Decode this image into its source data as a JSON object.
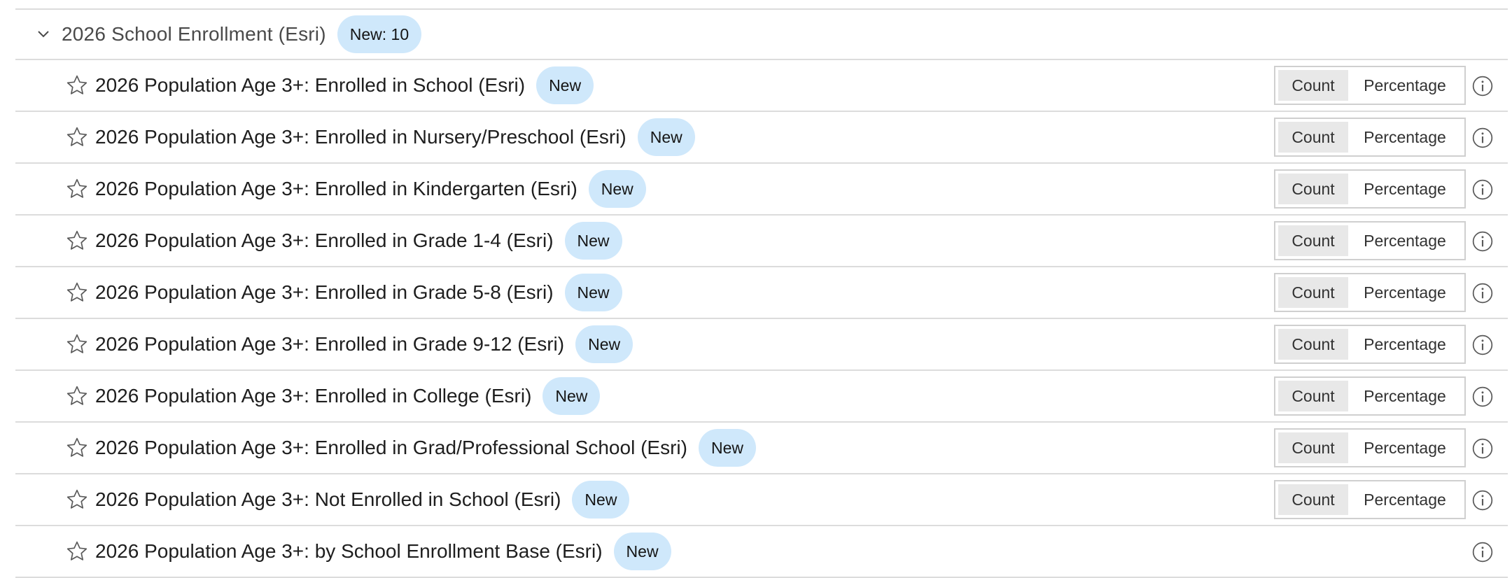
{
  "group": {
    "title": "2026 School Enrollment (Esri)",
    "badge": "New: 10",
    "expanded": true
  },
  "rows": [
    {
      "label": "2026 Population Age 3+: Enrolled in School (Esri)",
      "badge": "New",
      "count_label": "Count",
      "pct_label": "Percentage",
      "has_toggle": true
    },
    {
      "label": "2026 Population Age 3+: Enrolled in Nursery/Preschool (Esri)",
      "badge": "New",
      "count_label": "Count",
      "pct_label": "Percentage",
      "has_toggle": true
    },
    {
      "label": "2026 Population Age 3+: Enrolled in Kindergarten (Esri)",
      "badge": "New",
      "count_label": "Count",
      "pct_label": "Percentage",
      "has_toggle": true
    },
    {
      "label": "2026 Population Age 3+: Enrolled in Grade 1-4 (Esri)",
      "badge": "New",
      "count_label": "Count",
      "pct_label": "Percentage",
      "has_toggle": true
    },
    {
      "label": "2026 Population Age 3+: Enrolled in Grade 5-8 (Esri)",
      "badge": "New",
      "count_label": "Count",
      "pct_label": "Percentage",
      "has_toggle": true
    },
    {
      "label": "2026 Population Age 3+: Enrolled in Grade 9-12 (Esri)",
      "badge": "New",
      "count_label": "Count",
      "pct_label": "Percentage",
      "has_toggle": true
    },
    {
      "label": "2026 Population Age 3+: Enrolled in College (Esri)",
      "badge": "New",
      "count_label": "Count",
      "pct_label": "Percentage",
      "has_toggle": true
    },
    {
      "label": "2026 Population Age 3+: Enrolled in Grad/Professional School (Esri)",
      "badge": "New",
      "count_label": "Count",
      "pct_label": "Percentage",
      "has_toggle": true
    },
    {
      "label": "2026 Population Age 3+: Not Enrolled in School (Esri)",
      "badge": "New",
      "count_label": "Count",
      "pct_label": "Percentage",
      "has_toggle": true
    },
    {
      "label": "2026 Population Age 3+: by School Enrollment Base (Esri)",
      "badge": "New",
      "has_toggle": false
    }
  ],
  "icons": {
    "chevron": "chevron-down-icon",
    "star": "star-outline-icon",
    "info": "info-icon"
  },
  "colors": {
    "badge_bg": "#cfe8fb",
    "divider": "#dcdcdc",
    "selected_segment": "#e8e8e8"
  }
}
